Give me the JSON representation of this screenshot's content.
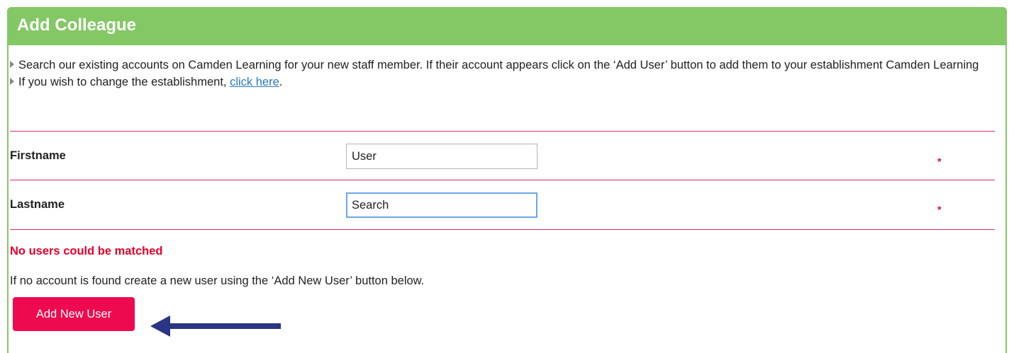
{
  "panel": {
    "title": "Add Colleague"
  },
  "intro": {
    "line1": "Search our existing accounts on Camden Learning for your new staff member. If their account appears click on the ‘Add User’ button to add them to your establishment Camden Learning",
    "line2_prefix": "If you wish to change the establishment, ",
    "line2_link": "click here",
    "line2_suffix": "."
  },
  "form": {
    "firstname": {
      "label": "Firstname",
      "value": "User",
      "required_mark": "*"
    },
    "lastname": {
      "label": "Lastname",
      "value": "Search",
      "required_mark": "*"
    }
  },
  "results": {
    "message": "No users could be matched",
    "hint": "If no account is found create a new user using the ‘Add New User’ button below."
  },
  "actions": {
    "add_new_user_label": "Add New User"
  },
  "colors": {
    "header_green": "#84c866",
    "accent_red": "#ee0a4e",
    "divider_pink": "#e03060",
    "link_blue": "#2a7ac0",
    "arrow_navy": "#2b3585"
  }
}
